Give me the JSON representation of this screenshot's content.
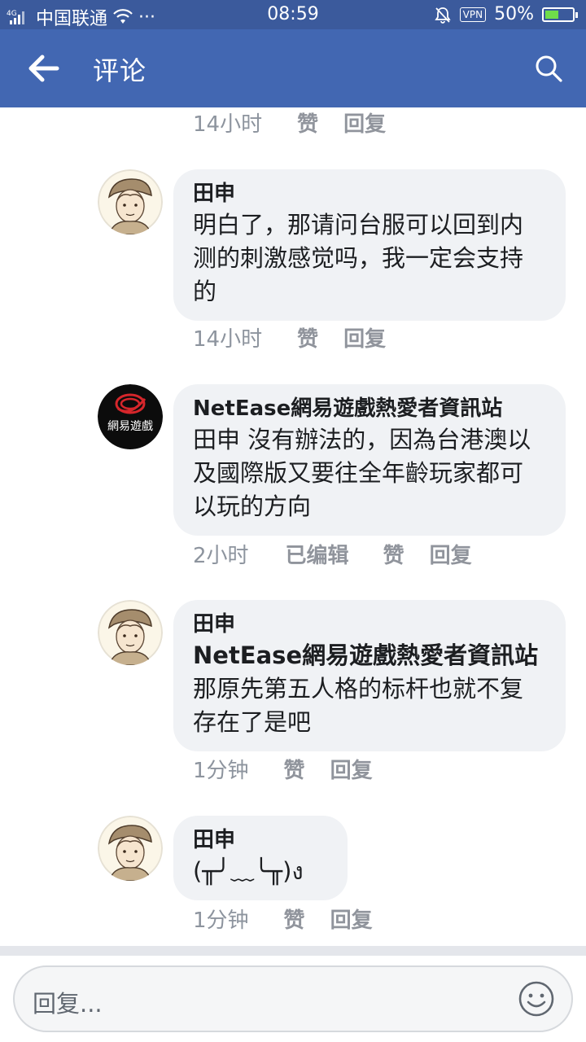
{
  "status_bar": {
    "network": "4G",
    "carrier": "中国联通",
    "dots": "···",
    "time": "08:59",
    "vpn": "VPN",
    "battery": "50%",
    "battery_level": 0.5
  },
  "header": {
    "title": "评论"
  },
  "top_meta": {
    "time": "14小时",
    "like": "赞",
    "reply": "回复"
  },
  "comments": [
    {
      "author": "田申",
      "text": "明白了，那请问台服可以回到内测的刺激感觉吗，我一定会支持的",
      "time": "14小时",
      "edited": "",
      "like": "赞",
      "reply": "回复",
      "avatar": "sketch-boy-avatar"
    },
    {
      "author": "NetEase網易遊戲熱愛者資訊站",
      "text": "田申 沒有辦法的，因為台港澳以及國際版又要往全年齡玩家都可以玩的方向",
      "time": "2小时",
      "edited": "已编辑",
      "like": "赞",
      "reply": "回复",
      "avatar": "netease-games-logo",
      "avatar_logo_text": "網易遊戲"
    },
    {
      "author": "田申",
      "mention": "NetEase網易遊戲熱愛者資訊站",
      "text": "那原先第五人格的标杆也就不复存在了是吧",
      "time": "1分钟",
      "edited": "",
      "like": "赞",
      "reply": "回复",
      "avatar": "sketch-boy-avatar"
    },
    {
      "author": "田申",
      "text": "(╥╯﹏╰╥)ง",
      "time": "1分钟",
      "edited": "",
      "like": "赞",
      "reply": "回复",
      "avatar": "sketch-boy-avatar"
    }
  ],
  "composer": {
    "placeholder": "回复...",
    "emoji_icon": "smiley-icon"
  },
  "colors": {
    "app_bar": "#4267b2",
    "status_bar": "#3b5a9c",
    "bubble": "#f0f2f5",
    "meta_text": "#8d949e"
  }
}
